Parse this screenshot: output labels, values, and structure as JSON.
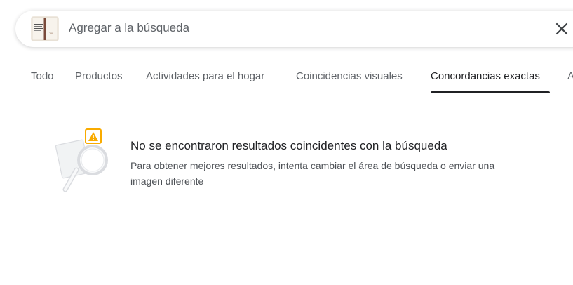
{
  "search": {
    "placeholder": "Agregar a la búsqueda",
    "value": "",
    "thumbnail_icon": "book-cover-thumbnail",
    "clear_icon": "close-icon"
  },
  "tabs": [
    {
      "label": "Todo",
      "active": false
    },
    {
      "label": "Productos",
      "active": false
    },
    {
      "label": "Actividades para el hogar",
      "active": false
    },
    {
      "label": "Coincidencias visuales",
      "active": false
    },
    {
      "label": "Concordancias exactas",
      "active": true
    },
    {
      "label": "A",
      "active": false
    }
  ],
  "empty_state": {
    "title": "No se encontraron resultados coincidentes con la búsqueda",
    "description": "Para obtener mejores resultados, intenta cambiar el área de búsqueda o enviar una imagen diferente",
    "icon": "no-results-magnifier-icon",
    "warning_icon": "warning-icon"
  },
  "colors": {
    "active_tab": "#202124",
    "inactive_tab": "#5f6368",
    "warning": "#f9ab00"
  }
}
